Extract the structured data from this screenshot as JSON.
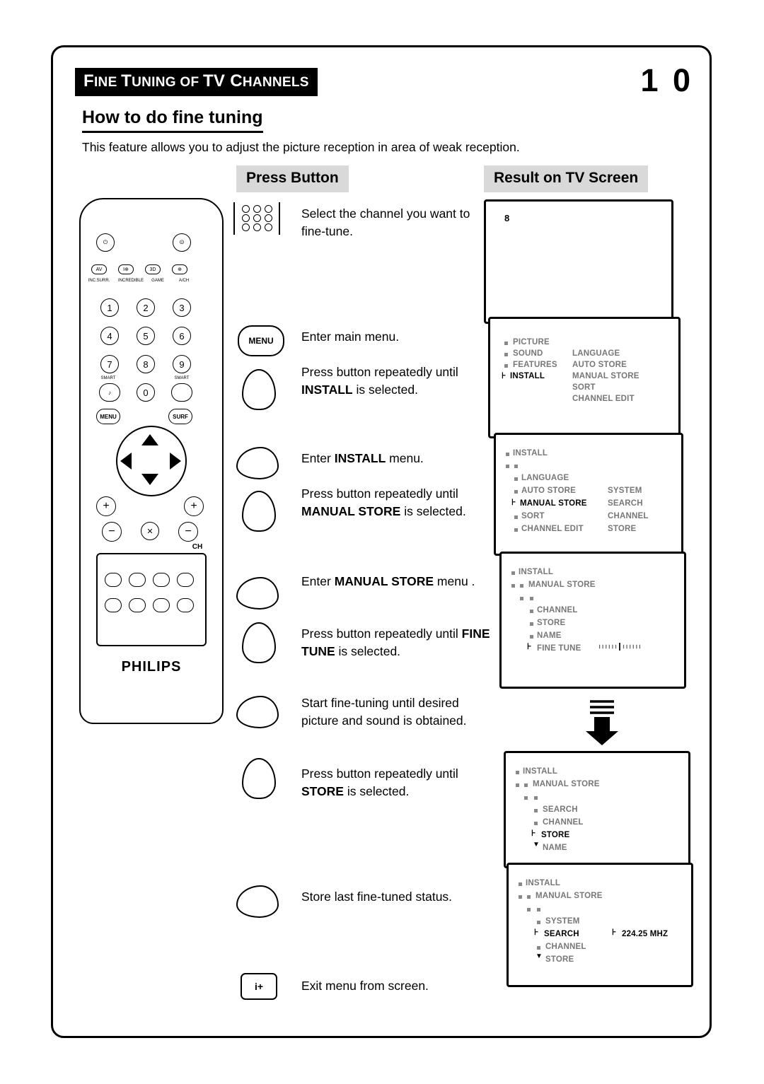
{
  "header": {
    "title_first": "F",
    "title_rest": "INE ",
    "title_full_parts": [
      "F",
      "INE ",
      "T",
      "UNING OF ",
      "TV C",
      "HANNELS"
    ],
    "page_number": "1 0",
    "subtitle": "How to do fine tuning",
    "intro": "This feature allows you to adjust the picture reception in area of weak reception."
  },
  "columns": {
    "press_button": "Press Button",
    "result_on_tv": "Result on TV Screen"
  },
  "remote": {
    "brand": "PHILIPS",
    "labels": {
      "av": "AV",
      "incr": "I⊕",
      "sur": "3D",
      "ach": "⊕",
      "row_caption_1": "INC.SURR.",
      "row_caption_2": "INCREDIBLE",
      "row_caption_3": "GAME",
      "row_caption_4": "A/CH",
      "smart_left": "SMART",
      "smart_right": "SMART",
      "menu": "MENU",
      "surf": "SURF",
      "ch": "CH",
      "numbers": [
        "1",
        "2",
        "3",
        "4",
        "5",
        "6",
        "7",
        "8",
        "9",
        "0"
      ],
      "plus": "+",
      "minus": "−",
      "mute": "🔇",
      "note": "♪",
      "oval": "▭"
    }
  },
  "steps": [
    {
      "icon": "keypad",
      "text_html": "Select the channel you want to fine-tune."
    },
    {
      "icon": "menu-button",
      "text_html": "Enter main menu."
    },
    {
      "icon": "cursor-down",
      "text_html": "Press button repeatedly until <b>INSTALL</b> is selected."
    },
    {
      "icon": "cursor-right",
      "text_html": "Enter <b>INSTALL</b> menu."
    },
    {
      "icon": "cursor-down",
      "text_html": "Press button repeatedly until <b>MANUAL STORE</b> is selected."
    },
    {
      "icon": "cursor-right",
      "text_html": "Enter <b>MANUAL STORE</b> menu ."
    },
    {
      "icon": "cursor-down",
      "text_html": "Press button repeatedly until <b>FINE TUNE</b> is selected."
    },
    {
      "icon": "cursor-right",
      "text_html": "Start fine-tuning until desired picture and sound is obtained."
    },
    {
      "icon": "cursor-down",
      "text_html": "Press button repeatedly until <b>STORE</b> is selected."
    },
    {
      "icon": "cursor-right",
      "text_html": "Store last fine-tuned status."
    },
    {
      "icon": "info-button",
      "text_html": "Exit menu from screen."
    }
  ],
  "step_plain": [
    "Select the channel you want to fine-tune.",
    "Enter main menu.",
    "Press button repeatedly until INSTALL is selected.",
    "Enter INSTALL menu.",
    "Press button repeatedly until MANUAL STORE is selected.",
    "Enter MANUAL STORE menu .",
    "Press button repeatedly until FINE TUNE is selected.",
    "Start fine-tuning until desired picture and sound is obtained.",
    "Press button repeatedly until STORE is selected.",
    "Store last fine-tuned status.",
    "Exit menu from screen."
  ],
  "screens": {
    "channel": {
      "number": "8"
    },
    "main_menu": {
      "left": [
        "PICTURE",
        "SOUND",
        "FEATURES",
        "INSTALL"
      ],
      "right": [
        "LANGUAGE",
        "AUTO STORE",
        "MANUAL STORE",
        "SORT",
        "CHANNEL EDIT"
      ],
      "selected": "INSTALL"
    },
    "install_menu": {
      "breadcrumb": "INSTALL",
      "left": [
        "LANGUAGE",
        "AUTO STORE",
        "MANUAL STORE",
        "SORT",
        "CHANNEL EDIT"
      ],
      "right": [
        "SYSTEM",
        "SEARCH",
        "CHANNEL",
        "STORE"
      ],
      "selected": "MANUAL STORE"
    },
    "manual_store_menu": {
      "breadcrumb1": "INSTALL",
      "breadcrumb2": "MANUAL STORE",
      "items": [
        "CHANNEL",
        "STORE",
        "NAME",
        "FINE TUNE"
      ],
      "selected": "FINE TUNE"
    },
    "store_menu": {
      "breadcrumb1": "INSTALL",
      "breadcrumb2": "MANUAL STORE",
      "items": [
        "SEARCH",
        "CHANNEL",
        "STORE",
        "NAME"
      ],
      "selected": "STORE"
    },
    "search_menu": {
      "breadcrumb1": "INSTALL",
      "breadcrumb2": "MANUAL STORE",
      "items": [
        "SYSTEM",
        "SEARCH",
        "CHANNEL",
        "STORE"
      ],
      "selected": "SEARCH",
      "frequency": "224.25 MHZ"
    }
  }
}
